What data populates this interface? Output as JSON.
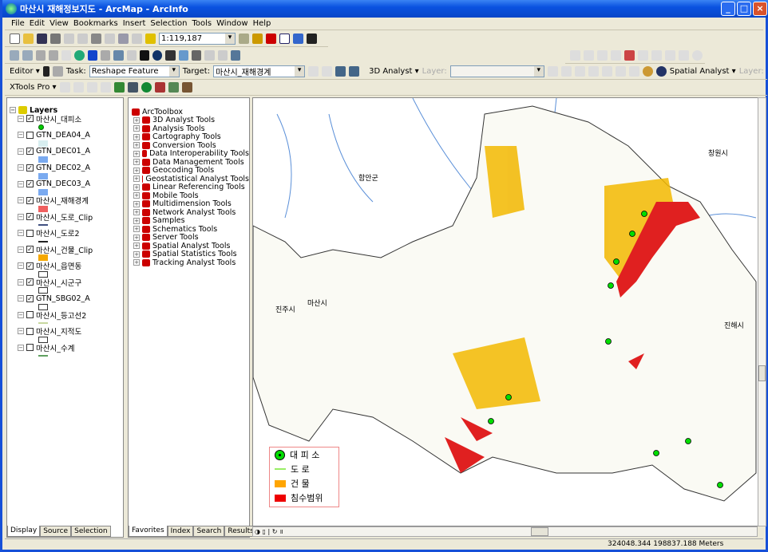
{
  "window": {
    "title": "마산시 재해정보지도 - ArcMap - ArcInfo",
    "controls": [
      "_",
      "□",
      "×"
    ]
  },
  "menu": [
    "File",
    "Edit",
    "View",
    "Bookmarks",
    "Insert",
    "Selection",
    "Tools",
    "Window",
    "Help"
  ],
  "standard_toolbar": {
    "scale": "1:119,187"
  },
  "editor_toolbar": {
    "editor_label": "Editor",
    "task_label": "Task:",
    "task_value": "Reshape Feature",
    "target_label": "Target:",
    "target_value": "마산시_재해경계"
  },
  "analyst_toolbar": {
    "analyst3d": "3D Analyst",
    "layer_label": "Layer:",
    "spatial_analyst": "Spatial Analyst",
    "layer_label2": "Layer:"
  },
  "xtools": {
    "label": "XTools Pro"
  },
  "toc": {
    "root": "Layers",
    "layers": [
      {
        "name": "마산시_대피소",
        "checked": true,
        "symbol": "point",
        "color": "#00cc00"
      },
      {
        "name": "GTN_DEA04_A",
        "checked": false,
        "symbol": "fill",
        "color": "#d8eef0"
      },
      {
        "name": "GTN_DEC01_A",
        "checked": true,
        "symbol": "fill",
        "color": "#7aaaf0"
      },
      {
        "name": "GTN_DEC02_A",
        "checked": true,
        "symbol": "fill",
        "color": "#7aaaf0"
      },
      {
        "name": "GTN_DEC03_A",
        "checked": true,
        "symbol": "fill",
        "color": "#7aaaf0"
      },
      {
        "name": "마산시_재해경계",
        "checked": true,
        "symbol": "fill",
        "color": "#f06060"
      },
      {
        "name": "마산시_도로_Clip",
        "checked": true,
        "symbol": "line",
        "color": "#405080"
      },
      {
        "name": "마산시_도로2",
        "checked": false,
        "symbol": "line",
        "color": "#222222"
      },
      {
        "name": "마산시_건물_Clip",
        "checked": true,
        "symbol": "fill",
        "color": "#f5a800"
      },
      {
        "name": "마산시_읍면동",
        "checked": true,
        "symbol": "outline",
        "color": "#ffffff"
      },
      {
        "name": "마산시_시군구",
        "checked": true,
        "symbol": "outline",
        "color": "#ffffff"
      },
      {
        "name": "GTN_SBG02_A",
        "checked": true,
        "symbol": "outline",
        "color": "#ffffff"
      },
      {
        "name": "마산시_등고선2",
        "checked": false,
        "symbol": "line",
        "color": "#c8d8a0"
      },
      {
        "name": "마산시_지적도",
        "checked": false,
        "symbol": "outline",
        "color": "#ffffff"
      },
      {
        "name": "마산시_수계",
        "checked": false,
        "symbol": "line",
        "color": "#60a060"
      }
    ],
    "tabs": [
      "Display",
      "Source",
      "Selection"
    ]
  },
  "toolbox": {
    "root": "ArcToolbox",
    "tools": [
      "3D Analyst Tools",
      "Analysis Tools",
      "Cartography Tools",
      "Conversion Tools",
      "Data Interoperability Tools",
      "Data Management Tools",
      "Geocoding Tools",
      "Geostatistical Analyst Tools",
      "Linear Referencing Tools",
      "Mobile Tools",
      "Multidimension Tools",
      "Network Analyst Tools",
      "Samples",
      "Schematics Tools",
      "Server Tools",
      "Spatial Analyst Tools",
      "Spatial Statistics Tools",
      "Tracking Analyst Tools"
    ],
    "tabs": [
      "Favorites",
      "Index",
      "Search",
      "Results"
    ]
  },
  "map": {
    "place_labels": [
      "함안군",
      "창원시",
      "진주시",
      "진해시",
      "마산시"
    ],
    "legend": [
      {
        "label": "대 피 소",
        "symbol": "point",
        "color": "#00dd00"
      },
      {
        "label": "도 로",
        "symbol": "line",
        "color": "#99ee66"
      },
      {
        "label": "건 물",
        "symbol": "fill",
        "color": "#ffa500"
      },
      {
        "label": "침수범위",
        "symbol": "fill",
        "color": "#ee0000"
      }
    ]
  },
  "status": {
    "coords": "324048.344  198837.188 Meters"
  }
}
